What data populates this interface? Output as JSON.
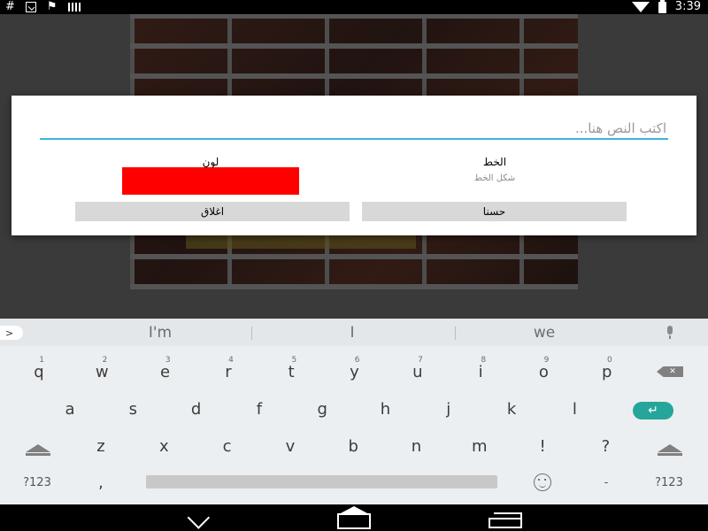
{
  "status_bar": {
    "hash_icon": "#",
    "time": "3:39",
    "icons": [
      "hash-icon",
      "download-icon",
      "flag-icon",
      "signal-bars-icon",
      "wifi-icon",
      "battery-icon"
    ]
  },
  "dialog": {
    "text_placeholder": "اكتب النص هنا...",
    "text_value": "",
    "color_label": "لون",
    "color_value": "#ff0000",
    "font_label": "الخط",
    "font_sample": "شكل الخط",
    "close_button": "اغلاق",
    "ok_button": "حسنا"
  },
  "keyboard": {
    "expand_label": ">",
    "suggestions": [
      "I'm",
      "I",
      "we"
    ],
    "row1": [
      {
        "k": "q",
        "h": "1"
      },
      {
        "k": "w",
        "h": "2"
      },
      {
        "k": "e",
        "h": "3"
      },
      {
        "k": "r",
        "h": "4"
      },
      {
        "k": "t",
        "h": "5"
      },
      {
        "k": "y",
        "h": "6"
      },
      {
        "k": "u",
        "h": "7"
      },
      {
        "k": "i",
        "h": "8"
      },
      {
        "k": "o",
        "h": "9"
      },
      {
        "k": "p",
        "h": "0"
      }
    ],
    "row2": [
      "a",
      "s",
      "d",
      "f",
      "g",
      "h",
      "j",
      "k",
      "l"
    ],
    "row3": [
      "z",
      "x",
      "c",
      "v",
      "b",
      "n",
      "m",
      "!",
      "?"
    ],
    "symbols_label": "?123",
    "comma": ",",
    "dash": "-",
    "symbols_label_right": "?123",
    "enter_color": "#26a69a"
  }
}
